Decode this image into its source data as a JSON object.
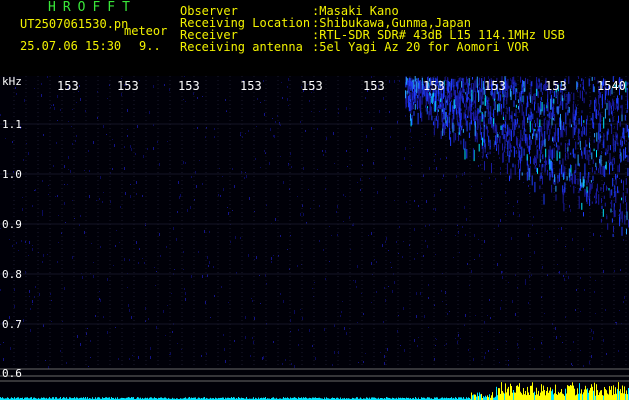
{
  "header": {
    "logo": "HROFFT",
    "filename": "UT2507061530.pn",
    "event_type": "meteor",
    "datetime": "25.07.06 15:30",
    "count": "9.."
  },
  "info": {
    "observer_label": "Observer",
    "observer_value": ":Masaki Kano",
    "location_label": "Receiving Location",
    "location_value": ":Shibukawa,Gunma,Japan",
    "receiver_label": "Receiver",
    "receiver_value": ":RTL-SDR SDR# 43dB L15 114.1MHz USB",
    "antenna_label": "Receiving antenna",
    "antenna_value": ":5el Yagi Az 20 for Aomori VOR"
  },
  "axis": {
    "y_unit": "kHz",
    "y_ticks": [
      "1.1",
      "1.0",
      "0.9",
      "0.8",
      "0.7",
      "0.6"
    ],
    "x_ticks": [
      "153",
      "153",
      "153",
      "153",
      "153",
      "153",
      "153",
      "153",
      "153",
      "1540"
    ]
  },
  "colors": {
    "background": "#000000",
    "green_text": "#39e639",
    "yellow_text": "#f2f200",
    "white_text": "#ffffff",
    "grid": "#3a3a3a",
    "signal_blue": "#1e3cff",
    "signal_cyan": "#00e6ff",
    "signal_yellow": "#ffff00"
  }
}
